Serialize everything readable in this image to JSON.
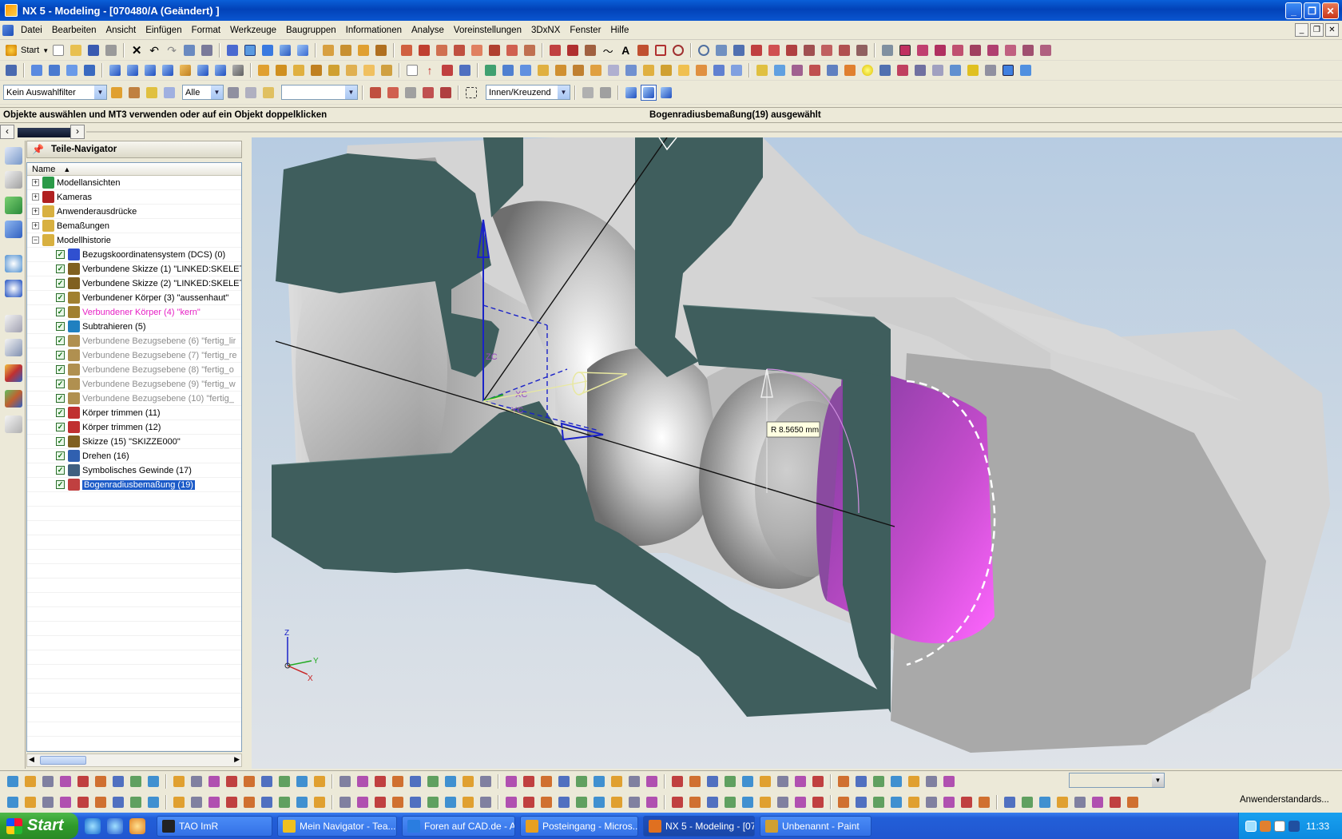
{
  "window": {
    "title": "NX 5 - Modeling - [070480/A (Geändert) ]"
  },
  "menu": [
    "Datei",
    "Bearbeiten",
    "Ansicht",
    "Einfügen",
    "Format",
    "Werkzeuge",
    "Baugruppen",
    "Informationen",
    "Analyse",
    "Voreinstellungen",
    "3DxNX",
    "Fenster",
    "Hilfe"
  ],
  "toolbar": {
    "start_label": "Start",
    "filter_value": "Kein Auswahlfilter",
    "scope_value": "Alle",
    "blank_value": "",
    "mode_value": "Innen/Kreuzend"
  },
  "status": {
    "prompt": "Objekte auswählen und MT3 verwenden oder auf ein Objekt doppelklicken",
    "selection": "Bogenradiusbemaßung(19) ausgewählt"
  },
  "navigator": {
    "title": "Teile-Navigator",
    "column": "Name",
    "items": [
      {
        "label": "Modellansichten",
        "level": 0,
        "expand": "+",
        "icon": "model-views-icon",
        "color": "#2a9a48"
      },
      {
        "label": "Kameras",
        "level": 0,
        "expand": "+",
        "icon": "camera-icon",
        "color": "#b02020"
      },
      {
        "label": "Anwenderausdrücke",
        "level": 0,
        "expand": "+",
        "icon": "folder-icon",
        "color": "#d8b040"
      },
      {
        "label": "Bemaßungen",
        "level": 0,
        "expand": "+",
        "icon": "folder-icon",
        "color": "#d8b040"
      },
      {
        "label": "Modellhistorie",
        "level": 0,
        "expand": "−",
        "icon": "folder-open-icon",
        "color": "#d8b040"
      },
      {
        "label": "Bezugskoordinatensystem (DCS) (0)",
        "level": 1,
        "state": "normal",
        "icon": "datum-csys-icon",
        "color": "#3050d0"
      },
      {
        "label": "Verbundene Skizze (1) \"LINKED:SKELET",
        "level": 1,
        "state": "normal",
        "icon": "sketch-icon",
        "color": "#806020"
      },
      {
        "label": "Verbundene Skizze (2) \"LINKED:SKELET",
        "level": 1,
        "state": "normal",
        "icon": "sketch-icon",
        "color": "#806020"
      },
      {
        "label": "Verbundener Körper (3) \"aussenhaut\"",
        "level": 1,
        "state": "normal",
        "icon": "linked-body-icon",
        "color": "#a08030"
      },
      {
        "label": "Verbundener Körper (4) \"kern\"",
        "level": 1,
        "state": "pink",
        "icon": "linked-body-icon",
        "color": "#a08030"
      },
      {
        "label": "Subtrahieren (5)",
        "level": 1,
        "state": "normal",
        "icon": "subtract-icon",
        "color": "#2080c0"
      },
      {
        "label": "Verbundene Bezugsebene (6) \"fertig_lir",
        "level": 1,
        "state": "gray",
        "icon": "datum-plane-icon",
        "color": "#b09050"
      },
      {
        "label": "Verbundene Bezugsebene (7) \"fertig_re",
        "level": 1,
        "state": "gray",
        "icon": "datum-plane-icon",
        "color": "#b09050"
      },
      {
        "label": "Verbundene Bezugsebene (8) \"fertig_o",
        "level": 1,
        "state": "gray",
        "icon": "datum-plane-icon",
        "color": "#b09050"
      },
      {
        "label": "Verbundene Bezugsebene (9) \"fertig_w",
        "level": 1,
        "state": "gray",
        "icon": "datum-plane-icon",
        "color": "#b09050"
      },
      {
        "label": "Verbundene Bezugsebene (10) \"fertig_",
        "level": 1,
        "state": "gray",
        "icon": "datum-plane-icon",
        "color": "#b09050"
      },
      {
        "label": "Körper trimmen (11)",
        "level": 1,
        "state": "normal",
        "icon": "trim-body-icon",
        "color": "#c03030"
      },
      {
        "label": "Körper trimmen (12)",
        "level": 1,
        "state": "normal",
        "icon": "trim-body-icon",
        "color": "#c03030"
      },
      {
        "label": "Skizze (15) \"SKIZZE000\"",
        "level": 1,
        "state": "normal",
        "icon": "sketch-icon",
        "color": "#806020"
      },
      {
        "label": "Drehen (16)",
        "level": 1,
        "state": "normal",
        "icon": "revolve-icon",
        "color": "#3060b0"
      },
      {
        "label": "Symbolisches Gewinde (17)",
        "level": 1,
        "state": "normal",
        "icon": "thread-icon",
        "color": "#406080"
      },
      {
        "label": "Bogenradiusbemaßung (19)",
        "level": 1,
        "state": "selected",
        "icon": "radius-dimension-icon",
        "color": "#c04040"
      }
    ]
  },
  "viewport": {
    "dimension_label": "R 8.5650 mm",
    "triad": {
      "x": "X",
      "y": "Y",
      "z": "Z"
    },
    "wcs": {
      "xc": "XC",
      "yc": "YC",
      "zc": "ZC"
    },
    "colors": {
      "cut_face": "#3f5e5d",
      "metal": "#c8c8c8",
      "highlight": "#e659e8",
      "axis": "#1a22c8"
    }
  },
  "bottom_toolbar": {
    "role_label": "Anwenderstandards..."
  },
  "taskbar": {
    "start": "Start",
    "tasks": [
      {
        "label": "TAO ImR",
        "active": false,
        "color": "#222"
      },
      {
        "label": "Mein Navigator - Tea...",
        "active": false,
        "color": "#f0c020"
      },
      {
        "label": "Foren auf CAD.de - A...",
        "active": false,
        "color": "#2a7de0"
      },
      {
        "label": "Posteingang - Micros...",
        "active": false,
        "color": "#e8a020"
      },
      {
        "label": "NX 5 - Modeling - [07...",
        "active": true,
        "color": "#e07020"
      },
      {
        "label": "Unbenannt - Paint",
        "active": false,
        "color": "#d0a030"
      }
    ],
    "clock": "11:33"
  }
}
